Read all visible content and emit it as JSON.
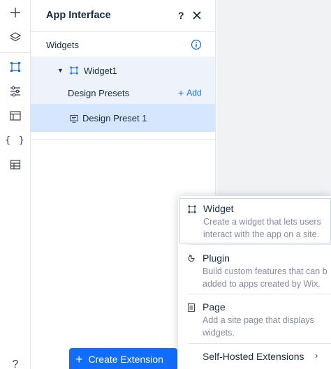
{
  "panel": {
    "title": "App Interface",
    "help": "?",
    "widgets_label": "Widgets",
    "widget_name": "Widget1",
    "design_presets_label": "Design Presets",
    "add_label": "Add",
    "preset_name": "Design Preset 1"
  },
  "rail": {
    "icons": [
      "plus-icon",
      "layers-icon",
      "widget-crop-icon",
      "sliders-icon",
      "window-icon",
      "code-braces-icon",
      "table-icon",
      "help-icon"
    ],
    "braces": "{ }",
    "help": "?"
  },
  "create_button": {
    "plus": "+",
    "label": "Create Extension"
  },
  "menu": {
    "items": [
      {
        "title": "Widget",
        "desc1": "Create a widget that lets users",
        "desc2": "interact with the app on a site."
      },
      {
        "title": "Plugin",
        "desc1": "Build custom features that can b",
        "desc2": "added to apps created by Wix."
      },
      {
        "title": "Page",
        "desc1": "Add a site page that displays",
        "desc2": "widgets."
      },
      {
        "title": "Self-Hosted Extensions",
        "chevron": "›"
      }
    ]
  },
  "colors": {
    "accent": "#116dff",
    "selected_row": "#d6e6fe",
    "tree_bg": "#eef3fb",
    "canvas": "#f0f2f4"
  }
}
